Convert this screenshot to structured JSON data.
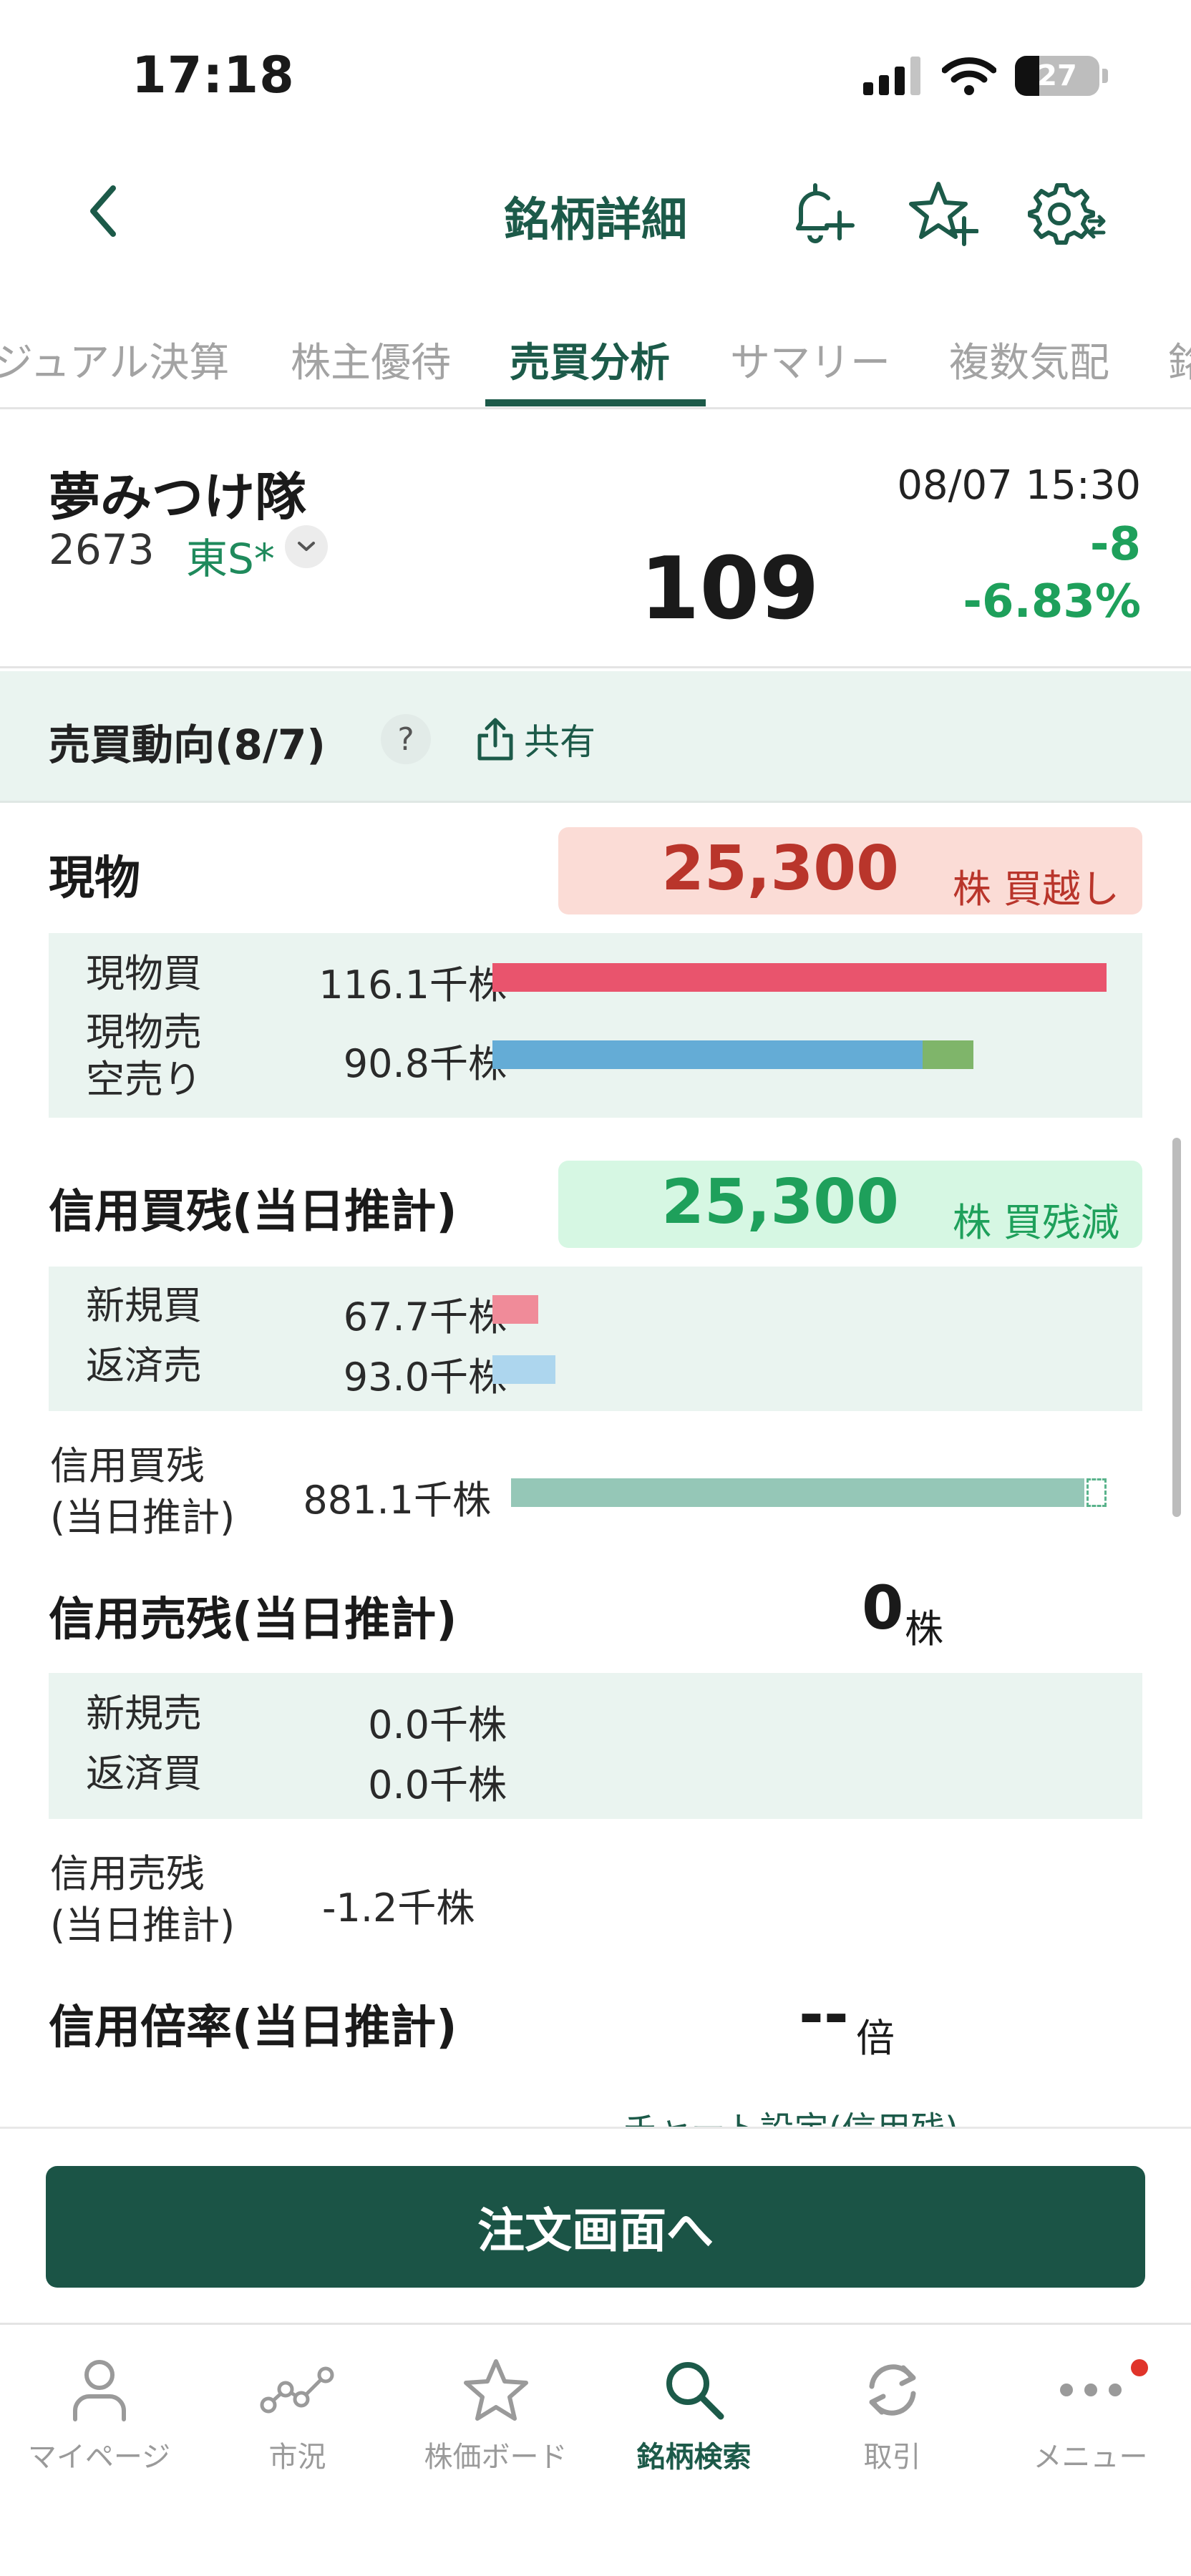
{
  "status_bar": {
    "time": "17:18",
    "battery": "27"
  },
  "nav": {
    "title": "銘柄詳細"
  },
  "tabs": [
    {
      "label": "ジュアル決算"
    },
    {
      "label": "株主優待"
    },
    {
      "label": "売買分析"
    },
    {
      "label": "サマリー"
    },
    {
      "label": "複数気配"
    },
    {
      "label": "銘"
    }
  ],
  "stock": {
    "name": "夢みつけ隊",
    "code": "2673",
    "market": "東S*",
    "datetime": "08/07 15:30",
    "price": "109",
    "change": "-8",
    "change_pct": "-6.83%"
  },
  "trend": {
    "title": "売買動向(8/7)",
    "help": "?",
    "share_label": "共有"
  },
  "spot": {
    "title": "現物",
    "net_value": "25,300",
    "net_unit": "株 買越し",
    "rows": [
      {
        "label": "現物買",
        "value": "116.1千株",
        "bar_fraction": 1.0
      },
      {
        "label": "現物売",
        "label2": "空売り",
        "value": "90.8千株",
        "bar_fraction": 0.7,
        "short_fraction": 0.083
      }
    ]
  },
  "margin_buy": {
    "title": "信用買残(当日推計)",
    "net_value": "25,300",
    "net_unit": "株 買残減",
    "rows": [
      {
        "label": "新規買",
        "value": "67.7千株",
        "bar_fraction": 0.075
      },
      {
        "label": "返済売",
        "value": "93.0千株",
        "bar_fraction": 0.103
      }
    ],
    "balance_label": "信用買残",
    "balance_label2": "(当日推計)",
    "balance_value": "881.1千株",
    "balance_fraction": 0.97
  },
  "margin_sell": {
    "title": "信用売残(当日推計)",
    "net_value": "0",
    "net_unit": "株",
    "rows": [
      {
        "label": "新規売",
        "value": "0.0千株"
      },
      {
        "label": "返済買",
        "value": "0.0千株"
      }
    ],
    "balance_label": "信用売残",
    "balance_label2": "(当日推計)",
    "balance_value": "-1.2千株"
  },
  "margin_ratio": {
    "title": "信用倍率(当日推計)",
    "value": "--",
    "unit": "倍"
  },
  "peek": "チャート設定(信用残)",
  "order_button": "注文画面へ",
  "bottom_tabs": [
    {
      "label": "マイページ"
    },
    {
      "label": "市況"
    },
    {
      "label": "株価ボード"
    },
    {
      "label": "銘柄検索"
    },
    {
      "label": "取引"
    },
    {
      "label": "メニュー"
    }
  ],
  "colors": {
    "brand": "#1c5a49",
    "up_red": "#b9352b",
    "down_green": "#1ea05b",
    "buy_bar": "#e9546d",
    "sell_bar": "#64acd6",
    "short_bar": "#7fb56a",
    "balance_bar": "#95c7b7"
  }
}
